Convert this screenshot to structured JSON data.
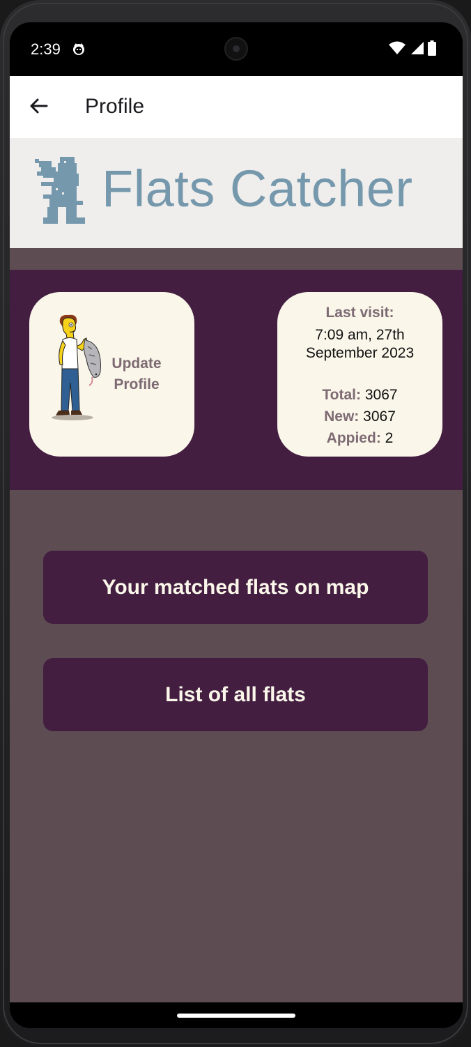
{
  "status_bar": {
    "time": "2:39",
    "icons": [
      "cat-face-icon",
      "wifi-icon",
      "cellular-signal-icon",
      "battery-icon"
    ]
  },
  "app_bar": {
    "back_icon": "arrow-left-icon",
    "title": "Profile"
  },
  "logo": {
    "icon": "berlin-bear-icon",
    "text": "Flats Catcher",
    "color": "#7598ad"
  },
  "profile_card": {
    "image": "man-holding-possum-illustration",
    "label_line1": "Update",
    "label_line2": "Profile"
  },
  "stats_card": {
    "last_visit_label": "Last visit:",
    "last_visit_line1": "7:09 am, 27th",
    "last_visit_line2": "September 2023",
    "total_label": "Total:",
    "total_value": "3067",
    "new_label": "New:",
    "new_value": "3067",
    "applied_label": "Appied:",
    "applied_value": "2"
  },
  "actions": {
    "map_button": "Your matched flats on map",
    "list_button": "List of all flats"
  },
  "colors": {
    "primary_dark": "#431e40",
    "background": "#5d4d53",
    "card": "#faf6ea",
    "label_muted": "#7d6a72",
    "banner": "#efeeec"
  }
}
